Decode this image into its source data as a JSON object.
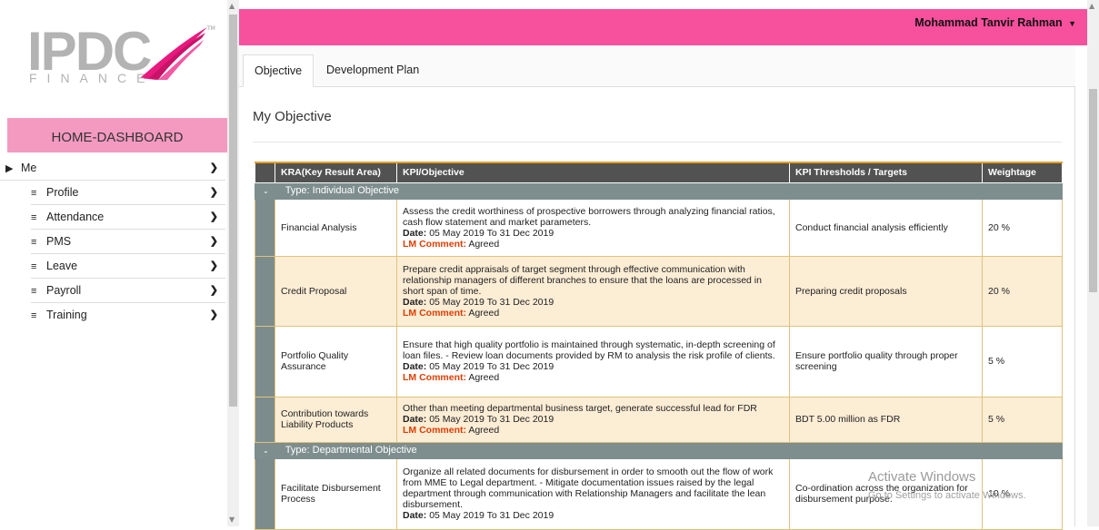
{
  "logo": {
    "main": "IPDC",
    "sub": "FINANCE",
    "tm": "TM"
  },
  "sidebar": {
    "home": "HOME-DASHBOARD",
    "me": "Me",
    "items": [
      {
        "label": "Profile"
      },
      {
        "label": "Attendance"
      },
      {
        "label": "PMS"
      },
      {
        "label": "Leave"
      },
      {
        "label": "Payroll"
      },
      {
        "label": "Training"
      }
    ]
  },
  "topbar": {
    "user": "Mohammad Tanvir Rahman"
  },
  "tabs": [
    {
      "label": "Objective"
    },
    {
      "label": "Development Plan"
    }
  ],
  "heading": "My Objective",
  "table": {
    "headers": [
      "KRA(Key Result Area)",
      "KPI/Objective",
      "KPI Thresholds / Targets",
      "Weightage"
    ],
    "groups": [
      {
        "label": "Type: Individual Objective"
      },
      {
        "label": "Type: Departmental Objective"
      }
    ],
    "date_label": "Date:",
    "lm_label": "LM Comment:",
    "rows": [
      {
        "kra": "Financial Analysis",
        "objective": "Assess the credit worthiness of prospective borrowers through analyzing financial ratios, cash flow statement and market parameters.",
        "date": "05 May 2019 To 31 Dec 2019",
        "lm": "Agreed",
        "target": "Conduct financial analysis efficiently",
        "weight": "20 %"
      },
      {
        "kra": "Credit Proposal",
        "objective": "Prepare credit appraisals of target segment through effective communication with relationship managers of different branches to ensure that the loans are processed in short span of time.",
        "date": "05 May 2019 To 31 Dec 2019",
        "lm": "Agreed",
        "target": "Preparing credit proposals",
        "weight": "20 %"
      },
      {
        "kra": "Portfolio Quality Assurance",
        "objective": "Ensure that high quality portfolio is maintained through systematic, in-depth screening of loan files. - Review loan documents provided by RM to analysis the risk profile of clients.",
        "date": "05 May 2019 To 31 Dec 2019",
        "lm": "Agreed",
        "target": "Ensure portfolio quality through proper screening",
        "weight": "5 %"
      },
      {
        "kra": "Contribution towards Liability Products",
        "objective": "Other than meeting departmental business target, generate successful lead for FDR",
        "date": "05 May 2019 To 31 Dec 2019",
        "lm": "Agreed",
        "target": "BDT 5.00 million as FDR",
        "weight": "5 %"
      },
      {
        "kra": "Facilitate Disbursement Process",
        "objective": "Organize all related documents for disbursement in order to smooth out the flow of work from MME to Legal department. - Mitigate documentation issues raised by the legal department through communication with Relationship Managers and facilitate the lean disbursement.",
        "date": "05 May 2019 To 31 Dec 2019",
        "target": "Co-ordination across the organization for disbursement purpose.",
        "weight": "10 %"
      }
    ]
  },
  "watermark": {
    "title": "Activate Windows",
    "sub": "Go to Settings to activate Windows."
  },
  "colors": {
    "topbar": "#f7509c",
    "home": "#f49ac1",
    "header": "#525252",
    "group": "#7e8e8e",
    "tan_row": "#fcedd5",
    "lm": "#e03c00"
  }
}
